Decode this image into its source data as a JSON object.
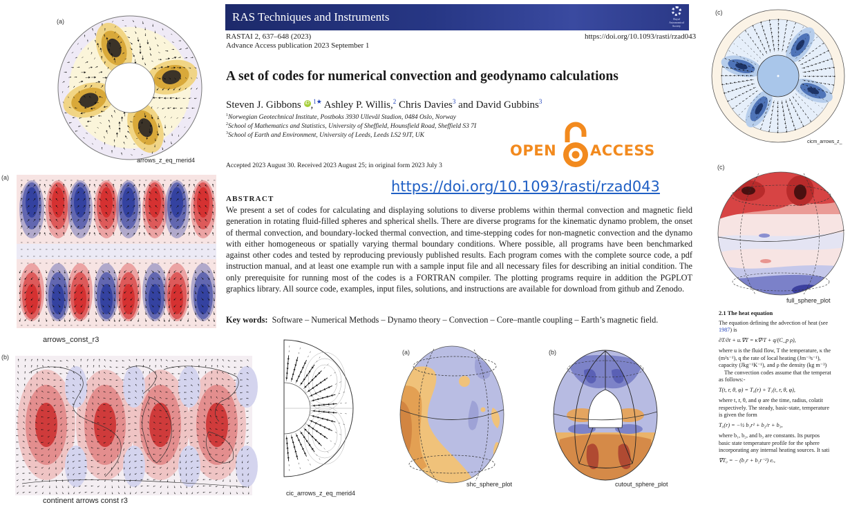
{
  "journal": {
    "banner_title": "RAS Techniques and Instruments",
    "society_logo": "royal-astronomical-society-logo",
    "citation": "RASTAI 2, 637–648 (2023)",
    "citation_volume": "2",
    "doi_header": "https://doi.org/10.1093/rasti/rzad043",
    "advance_access": "Advance Access publication 2023 September 1"
  },
  "paper": {
    "title": "A set of codes for numerical convection and geodynamo calculations",
    "authors": [
      {
        "name": "Steven J. Gibbons",
        "sup": "1★",
        "orcid": true
      },
      {
        "name": "Ashley P. Willis,",
        "sup": "2"
      },
      {
        "name": "Chris Davies",
        "sup": "3"
      },
      {
        "name": "David Gubbins",
        "sup": "3"
      }
    ],
    "author_joiner": "and",
    "affiliations": [
      {
        "num": "1",
        "text": "Norwegian Geotechnical Institute, Postboks 3930 Ullevål Stadion, 0484 Oslo, Norway"
      },
      {
        "num": "2",
        "text": "School of Mathematics and Statistics, University of Sheffield, Hounsfield Road, Sheffield S3 7I"
      },
      {
        "num": "3",
        "text": "School of Earth and Environment, University of Leeds, Leeds LS2 9JT, UK"
      }
    ],
    "dates": "Accepted 2023 August 30. Received 2023 August 25; in original form 2023 July 3",
    "abstract_heading": "ABSTRACT",
    "abstract": "We present a set of codes for calculating and displaying solutions to diverse problems within thermal convection and magnetic field generation in rotating fluid-filled spheres and spherical shells. There are diverse programs for the kinematic dynamo problem, the onset of thermal convection, and boundary-locked thermal convection, and time-stepping codes for non-magnetic convection and the dynamo with either homogeneous or spatially varying thermal boundary conditions. Where possible, all programs have been benchmarked against other codes and tested by reproducing previously published results. Each program comes with the complete source code, a pdf instruction manual, and at least one example run with a sample input file and all necessary files for describing an initial condition. The only prerequisite for running most of the codes is a FORTRAN compiler. The plotting programs require in addition the PGPLOT graphics library. All source code, examples, input files, solutions, and instructions are available for download from github and Zenodo.",
    "keywords_label": "Key words:",
    "keywords": "Software – Numerical Methods – Dynamo theory – Convection – Core–mantle coupling – Earth’s magnetic field."
  },
  "open_access": {
    "left_word": "OPEN",
    "right_word": "ACCESS",
    "icon": "open-padlock-icon",
    "color": "#f28a1e"
  },
  "doi_link": "https://doi.org/10.1093/rasti/rzad043",
  "heat_section": {
    "heading": "2.1 The heat equation",
    "intro_1": "The equation defining the advection of heat (see",
    "intro_ref": "1987",
    "intro_2": ") is",
    "eq1": "∂T/∂t + u.∇T = κ∇²T + q/(C_p ρ),",
    "line1": "where u is the fluid flow, T the temperature, κ the",
    "line2": "(m²s⁻¹), q the rate of local heating (Jm⁻³s⁻¹),",
    "line3": "capacity (Jkg⁻¹K⁻¹), and ρ the density (kg m⁻³)",
    "line4": "    The convection codes assume that the temperat",
    "line5": "as follows:-",
    "eq2": "T(t, r, θ, φ) = T₀(r) + T₁(t, r, θ, φ),",
    "line6": "where t, r, θ, and φ are the time, radius, colatit",
    "line7": "respectively. The steady, basic-state, temperature",
    "line8": "is given the form",
    "eq3": "T₀(r) = −½ b₁r² + b₂/r + b₃,",
    "line9": "where b₁, b₂, and b₃ are constants. Its purpos",
    "line10": "basic state temperature profile for the sphere",
    "line11": "incorporating any internal heating sources. It sati",
    "eq4": "∇T₀ = − (b₁r + b₂r⁻²) eᵣ,"
  },
  "figures": {
    "arrows_z_eq_merid4": {
      "label": "(a)",
      "caption": "arrows_z_eq_merid4",
      "colormap": [
        "#f4f1fb",
        "#fbf3cf",
        "#f0d27a",
        "#d9a93a",
        "#3b3328"
      ]
    },
    "arrows_const_r3": {
      "label": "(a)",
      "caption": "arrows_const_r3",
      "colors": {
        "red": "#d42a2a",
        "blue": "#2d3c9e",
        "bg_red": "#f9e0de",
        "bg_blue": "#e4e5f4"
      }
    },
    "continent_arrows_const_r3": {
      "label": "(b)",
      "caption": "continent  arrows  const  r3"
    },
    "cic_arrows_z_eq_merid4": {
      "caption": "cic_arrows_z_eq_merid4"
    },
    "shc_sphere_plot": {
      "label": "(a)",
      "caption": "shc_sphere_plot",
      "colors": {
        "orange": "#e6a65a",
        "lavender": "#b9bde3"
      }
    },
    "cutout_sphere_plot": {
      "label": "(b)",
      "caption": "cutout_sphere_plot"
    },
    "cicm_arrows": {
      "label": "(c)",
      "caption": "cicm_arrows_z_"
    },
    "full_sphere_plot": {
      "label": "(c)",
      "caption": "full_sphere_plot"
    }
  }
}
